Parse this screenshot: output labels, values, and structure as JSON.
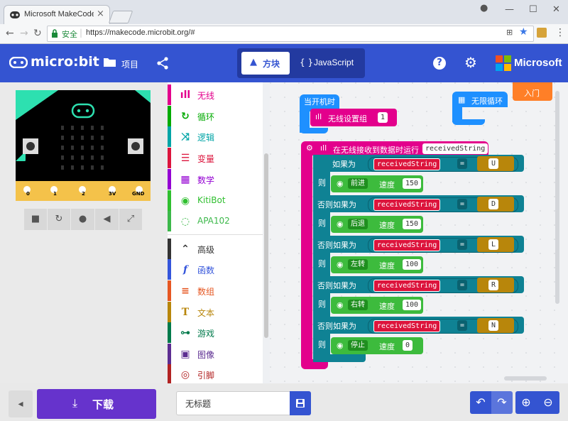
{
  "browser": {
    "tab_title": "Microsoft MakeCode fo",
    "secure_label": "安全",
    "url": "https://makecode.microbit.org/#"
  },
  "header": {
    "logo": "micro:bit",
    "projects": "项目",
    "blocks_tab": "方块",
    "js_tab": "JavaScript",
    "microsoft": "Microsoft"
  },
  "toolbox": {
    "categories": [
      {
        "label": "无线",
        "color": "#e3008c",
        "icon": "signal-icon"
      },
      {
        "label": "循环",
        "color": "#00aa00",
        "icon": "loop-icon"
      },
      {
        "label": "逻辑",
        "color": "#00a4a6",
        "icon": "shuffle-icon"
      },
      {
        "label": "变量",
        "color": "#dc143c",
        "icon": "lines-icon"
      },
      {
        "label": "数学",
        "color": "#9400d3",
        "icon": "calculator-icon"
      },
      {
        "label": "KitiBot",
        "color": "#2fbf2f",
        "icon": "cat-icon"
      },
      {
        "label": "APA102",
        "color": "#3cb84a",
        "icon": "dots-ring-icon"
      }
    ],
    "advanced": [
      {
        "label": "高级",
        "color": "#333333",
        "icon": "chevron-up-icon"
      },
      {
        "label": "函数",
        "color": "#3455db",
        "icon": "function-icon"
      },
      {
        "label": "数组",
        "color": "#e65722",
        "icon": "list-icon"
      },
      {
        "label": "文本",
        "color": "#b8860b",
        "icon": "text-icon"
      },
      {
        "label": "游戏",
        "color": "#007a4b",
        "icon": "gamepad-icon"
      },
      {
        "label": "图像",
        "color": "#5c2d91",
        "icon": "image-icon"
      },
      {
        "label": "引脚",
        "color": "#b22222",
        "icon": "pins-icon"
      }
    ]
  },
  "workspace": {
    "on_start": "当开机时",
    "set_group": "无线设置组",
    "group_value": "1",
    "forever": "无限循环",
    "tooltip": "入门",
    "on_received": "在无线接收到数据时运行",
    "received_var": "receivedString",
    "if_label": "如果为",
    "elseif_label": "否则如果为",
    "then_label": "则",
    "eq": "=",
    "speed_label": "速度",
    "rows": [
      {
        "char": "U",
        "action": "前进",
        "speed": "150"
      },
      {
        "char": "D",
        "action": "后退",
        "speed": "150"
      },
      {
        "char": "L",
        "action": "左转",
        "speed": "100"
      },
      {
        "char": "R",
        "action": "右转",
        "speed": "100"
      },
      {
        "char": "N",
        "action": "停止",
        "speed": "0"
      }
    ]
  },
  "simulator": {
    "pins": [
      "0",
      "1",
      "2",
      "3V",
      "GND"
    ],
    "button_a": "A",
    "button_b": "B"
  },
  "footer": {
    "download": "下载",
    "project_name": "无标题"
  },
  "colors": {
    "header_blue": "#3454d1",
    "download_purple": "#6633cc",
    "radio_pink": "#e3008c",
    "logic_teal": "#0f8294",
    "kitibot_green": "#3dbb3d",
    "loop_blue": "#1e90ff"
  }
}
